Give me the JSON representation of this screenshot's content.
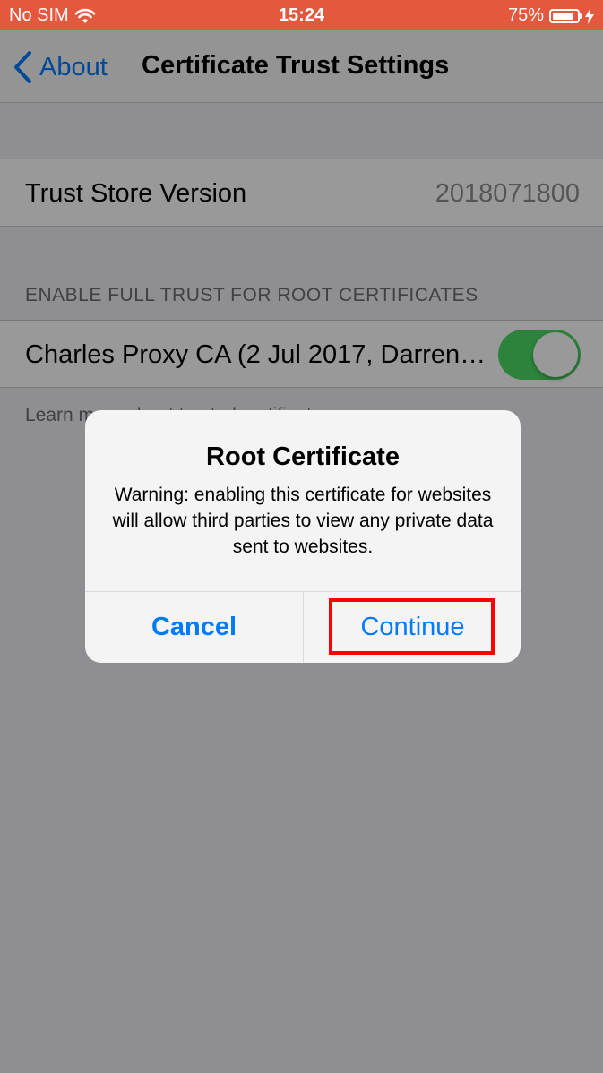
{
  "status_bar": {
    "carrier": "No SIM",
    "time": "15:24",
    "battery_percent": "75%",
    "battery_level": 0.75
  },
  "nav": {
    "back_label": "About",
    "title": "Certificate Trust Settings"
  },
  "trust_store": {
    "label": "Trust Store Version",
    "value": "2018071800"
  },
  "root_certs": {
    "section_header": "ENABLE FULL TRUST FOR ROOT CERTIFICATES",
    "certificate_name": "Charles Proxy CA (2 Jul 2017, Darren…",
    "toggle_on": true,
    "footer_text": "Learn more about trusted certificates"
  },
  "alert": {
    "title": "Root Certificate",
    "message": "Warning: enabling this certificate for websites will allow third parties to view any private data sent to websites.",
    "cancel_label": "Cancel",
    "continue_label": "Continue"
  },
  "colors": {
    "status_bar": "#e4583e",
    "accent": "#007aff",
    "toggle_on": "#4cd964",
    "highlight": "#ff0000"
  }
}
